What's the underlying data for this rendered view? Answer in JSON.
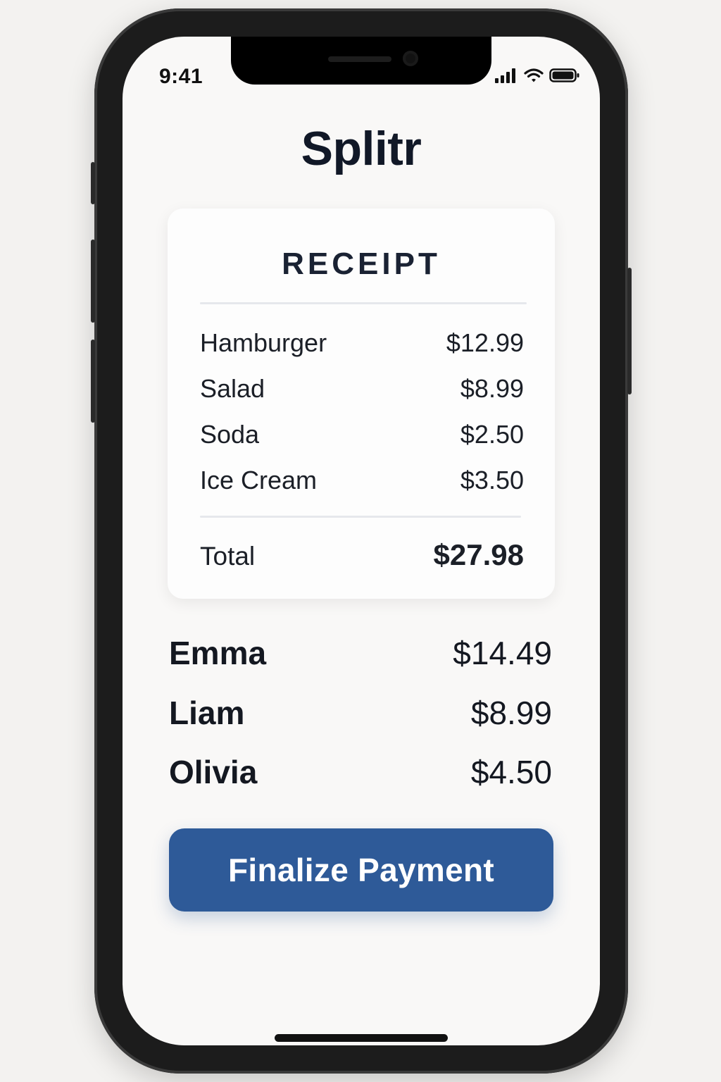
{
  "status_bar": {
    "time": "9:41",
    "icons": [
      "signal-icon",
      "wifi-icon",
      "battery-icon"
    ]
  },
  "app": {
    "title": "Splitr"
  },
  "receipt": {
    "title": "RECEIPT",
    "items": [
      {
        "name": "Hamburger",
        "price": "$12.99"
      },
      {
        "name": "Salad",
        "price": "$8.99"
      },
      {
        "name": "Soda",
        "price": "$2.50"
      },
      {
        "name": "Ice Cream",
        "price": "$3.50"
      }
    ],
    "total_label": "Total",
    "total_value": "$27.98"
  },
  "split": [
    {
      "name": "Emma",
      "amount": "$14.49"
    },
    {
      "name": "Liam",
      "amount": "$8.99"
    },
    {
      "name": "Olivia",
      "amount": "$4.50"
    }
  ],
  "actions": {
    "finalize_label": "Finalize Payment"
  },
  "colors": {
    "accent": "#2e5a98",
    "text": "#111827",
    "background": "#f9f8f7",
    "card": "#fdfdfd"
  }
}
